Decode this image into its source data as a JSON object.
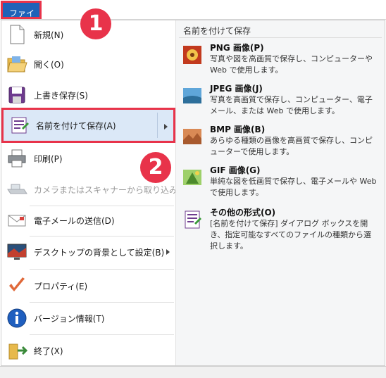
{
  "file_tab": "ファイル",
  "menu": {
    "items": [
      {
        "label": "新規(N)"
      },
      {
        "label": "開く(O)"
      },
      {
        "label": "上書き保存(S)"
      },
      {
        "label": "名前を付けて保存(A)"
      },
      {
        "label": "印刷(P)"
      },
      {
        "label": "カメラまたはスキャナーから取り込み(M)"
      },
      {
        "label": "電子メールの送信(D)"
      },
      {
        "label": "デスクトップの背景として設定(B)"
      },
      {
        "label": "プロパティ(E)"
      },
      {
        "label": "バージョン情報(T)"
      },
      {
        "label": "終了(X)"
      }
    ]
  },
  "saveas_panel": {
    "header": "名前を付けて保存",
    "items": [
      {
        "title": "PNG 画像(P)",
        "desc": "写真や図を高画質で保存し、コンピューターや Web で使用します。",
        "icon": "png-image-icon"
      },
      {
        "title": "JPEG 画像(J)",
        "desc": "写真を高画質で保存し、コンピューター、電子メール、または Web で使用します。",
        "icon": "jpeg-image-icon"
      },
      {
        "title": "BMP 画像(B)",
        "desc": "あらゆる種類の画像を高画質で保存し、コンピューターで使用します。",
        "icon": "bmp-image-icon"
      },
      {
        "title": "GIF 画像(G)",
        "desc": "単純な図を低画質で保存し、電子メールや Web で使用します。",
        "icon": "gif-image-icon"
      },
      {
        "title": "その他の形式(O)",
        "desc": "[名前を付けて保存] ダイアログ ボックスを開き、指定可能なすべてのファイルの種類から選択します。",
        "icon": "other-formats-icon"
      }
    ]
  },
  "callouts": {
    "step1": "1",
    "step2": "2"
  },
  "colors": {
    "accent_blue": "#1e62b8",
    "highlight": "#dbe8f7",
    "callout_red": "#e8334a"
  }
}
